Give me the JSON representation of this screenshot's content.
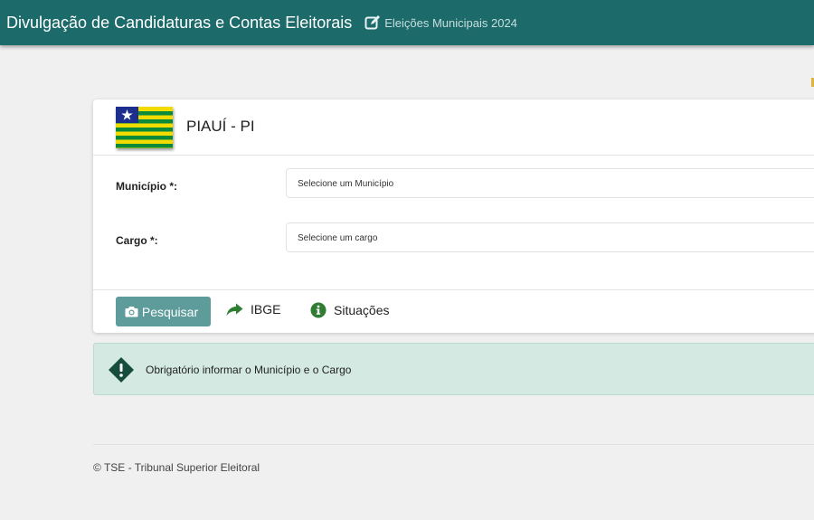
{
  "header": {
    "title": "Divulgação de Candidaturas e Contas Eleitorais",
    "subtitle": "Eleições Municipais 2024",
    "subtitle_icon": "edit-icon"
  },
  "state": {
    "name": "PIAUÍ - PI",
    "flag_icon": "piaui-flag"
  },
  "form": {
    "municipio_label": "Município *:",
    "municipio_placeholder": "Selecione um Município",
    "cargo_label": "Cargo *:",
    "cargo_placeholder": "Selecione um cargo"
  },
  "actions": {
    "search_label": "Pesquisar",
    "ibge_label": "IBGE",
    "situacoes_label": "Situações"
  },
  "alert": {
    "message": "Obrigatório informar o Município e o Cargo"
  },
  "footer": {
    "text": "© TSE - Tribunal Superior Eleitoral"
  },
  "colors": {
    "header_bg": "#1d6a6a",
    "accent": "#5e9b9b",
    "alert_bg": "#d3e9e2",
    "ibge_icon": "#2e7d32",
    "info_icon": "#2e7d32",
    "alert_icon": "#164d3d"
  }
}
